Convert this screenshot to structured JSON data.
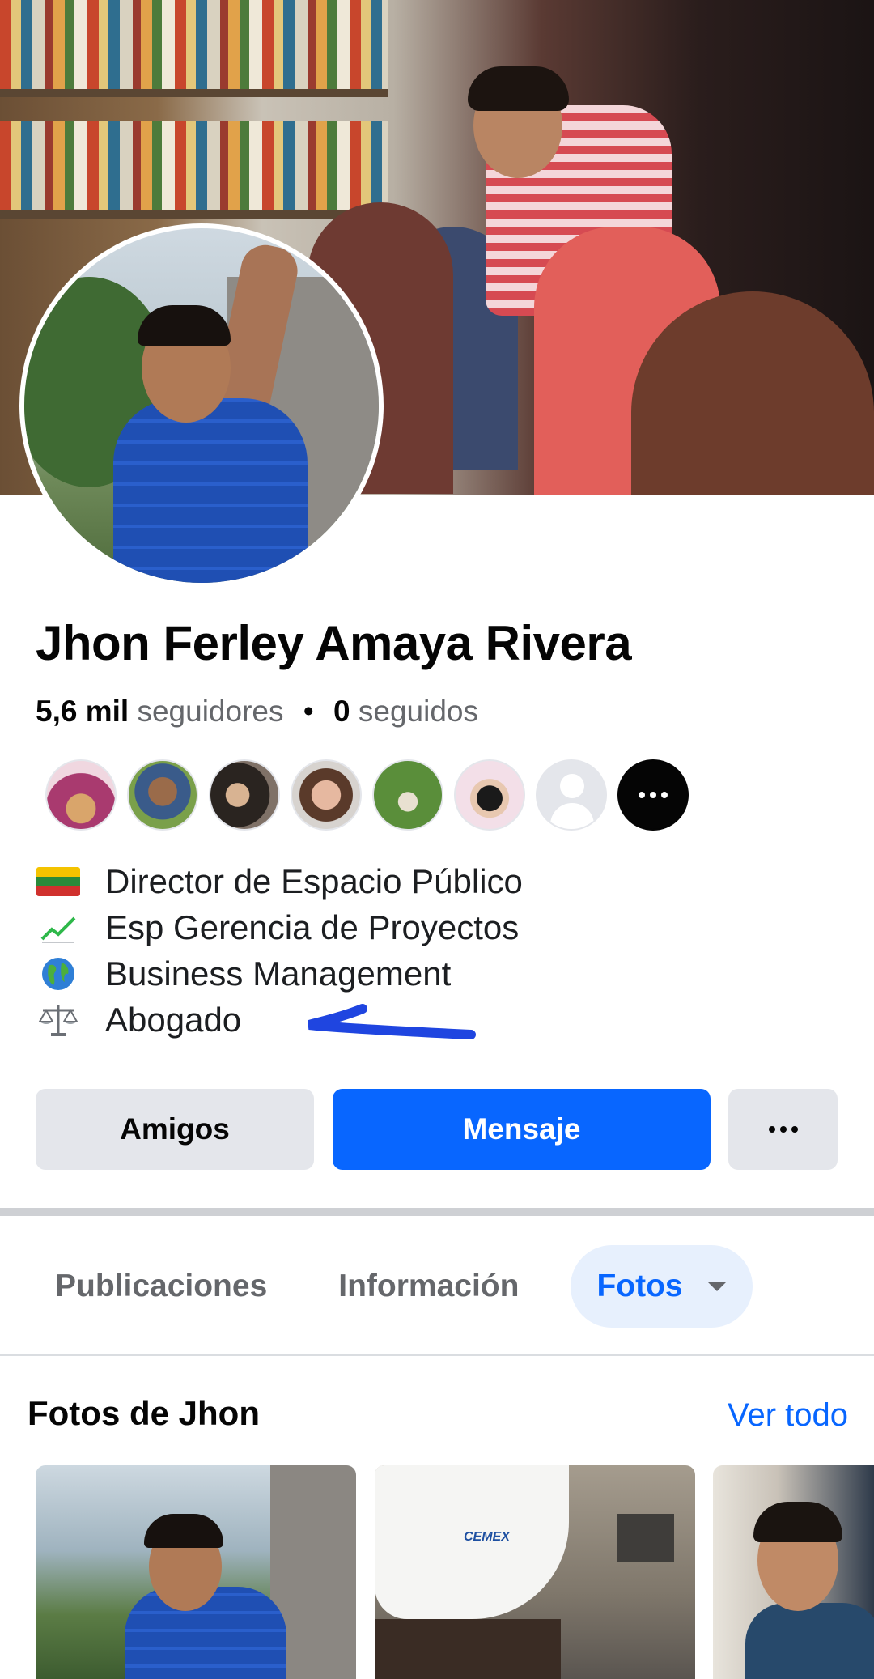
{
  "profile": {
    "name": "Jhon Ferley Amaya Rivera",
    "followers_count": "5,6 mil",
    "followers_label": "seguidores",
    "separator": "•",
    "following_count": "0",
    "following_label": "seguidos"
  },
  "friends_preview": {
    "count_shown": 7,
    "more_icon": "ellipsis-icon"
  },
  "bio": [
    {
      "icon": "flag-icon",
      "text": "Director de Espacio Público"
    },
    {
      "icon": "chart-increasing-icon",
      "text": "Esp Gerencia de Proyectos"
    },
    {
      "icon": "globe-icon",
      "text": "Business Management"
    },
    {
      "icon": "scales-icon",
      "text": "Abogado"
    }
  ],
  "actions": {
    "friends_label": "Amigos",
    "message_label": "Mensaje",
    "more_icon": "ellipsis-icon"
  },
  "tabs": [
    {
      "label": "Publicaciones",
      "active": false
    },
    {
      "label": "Información",
      "active": false
    },
    {
      "label": "Fotos",
      "active": true
    }
  ],
  "photos_section": {
    "title": "Fotos de Jhon",
    "see_all": "Ver todo",
    "helmet_logo": "CEMEX"
  },
  "colors": {
    "accent": "#0866ff",
    "button_secondary": "#e4e6eb",
    "active_tab_bg": "#e7f0fd",
    "annotation_scribble": "#1f45e0"
  }
}
